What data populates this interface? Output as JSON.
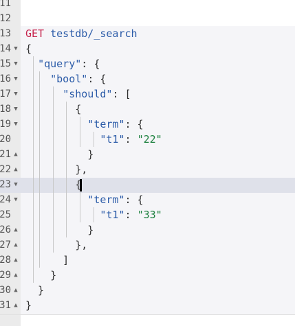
{
  "editor": {
    "lines": [
      {
        "no": "11",
        "fold": "",
        "segments": []
      },
      {
        "no": "12",
        "fold": "",
        "segments": []
      },
      {
        "no": "13",
        "fold": "",
        "segments": [
          {
            "t": "GET",
            "c": "method"
          },
          {
            "t": " ",
            "c": "punc"
          },
          {
            "t": "testdb/_search",
            "c": "path"
          }
        ]
      },
      {
        "no": "14",
        "fold": "▼",
        "segments": [
          {
            "t": "{",
            "c": "punc"
          }
        ]
      },
      {
        "no": "15",
        "fold": "▼",
        "segments": [
          {
            "t": "  ",
            "c": "punc"
          },
          {
            "t": "\"query\"",
            "c": "key"
          },
          {
            "t": ": {",
            "c": "punc"
          }
        ]
      },
      {
        "no": "16",
        "fold": "▼",
        "segments": [
          {
            "t": "    ",
            "c": "punc"
          },
          {
            "t": "\"bool\"",
            "c": "key"
          },
          {
            "t": ": {",
            "c": "punc"
          }
        ]
      },
      {
        "no": "17",
        "fold": "▼",
        "segments": [
          {
            "t": "      ",
            "c": "punc"
          },
          {
            "t": "\"should\"",
            "c": "key"
          },
          {
            "t": ": [",
            "c": "punc"
          }
        ]
      },
      {
        "no": "18",
        "fold": "▼",
        "segments": [
          {
            "t": "        {",
            "c": "punc"
          }
        ]
      },
      {
        "no": "19",
        "fold": "▼",
        "segments": [
          {
            "t": "          ",
            "c": "punc"
          },
          {
            "t": "\"term\"",
            "c": "key"
          },
          {
            "t": ": {",
            "c": "punc"
          }
        ]
      },
      {
        "no": "20",
        "fold": "",
        "segments": [
          {
            "t": "            ",
            "c": "punc"
          },
          {
            "t": "\"t1\"",
            "c": "key"
          },
          {
            "t": ": ",
            "c": "punc"
          },
          {
            "t": "\"22\"",
            "c": "str"
          }
        ]
      },
      {
        "no": "21",
        "fold": "▲",
        "segments": [
          {
            "t": "          }",
            "c": "punc"
          }
        ]
      },
      {
        "no": "22",
        "fold": "▲",
        "segments": [
          {
            "t": "        },",
            "c": "punc"
          }
        ]
      },
      {
        "no": "23",
        "fold": "▼",
        "segments": [
          {
            "t": "        {",
            "c": "punc"
          }
        ]
      },
      {
        "no": "24",
        "fold": "▼",
        "segments": [
          {
            "t": "          ",
            "c": "punc"
          },
          {
            "t": "\"term\"",
            "c": "key"
          },
          {
            "t": ": {",
            "c": "punc"
          }
        ]
      },
      {
        "no": "25",
        "fold": "",
        "segments": [
          {
            "t": "            ",
            "c": "punc"
          },
          {
            "t": "\"t1\"",
            "c": "key"
          },
          {
            "t": ": ",
            "c": "punc"
          },
          {
            "t": "\"33\"",
            "c": "str"
          }
        ]
      },
      {
        "no": "26",
        "fold": "▲",
        "segments": [
          {
            "t": "          }",
            "c": "punc"
          }
        ]
      },
      {
        "no": "27",
        "fold": "▲",
        "segments": [
          {
            "t": "        },",
            "c": "punc"
          }
        ]
      },
      {
        "no": "28",
        "fold": "▲",
        "segments": [
          {
            "t": "      ]",
            "c": "punc"
          }
        ]
      },
      {
        "no": "29",
        "fold": "▲",
        "segments": [
          {
            "t": "    }",
            "c": "punc"
          }
        ]
      },
      {
        "no": "30",
        "fold": "▲",
        "segments": [
          {
            "t": "  }",
            "c": "punc"
          }
        ]
      },
      {
        "no": "31",
        "fold": "▲",
        "segments": [
          {
            "t": "}",
            "c": "punc"
          }
        ]
      }
    ],
    "active_line": "23",
    "colors": {
      "method": "#c7254e",
      "key": "#2b5ba8",
      "string": "#1a7f3c",
      "gutter": "#ebebeb",
      "active_line": "#dfe1ea"
    }
  }
}
